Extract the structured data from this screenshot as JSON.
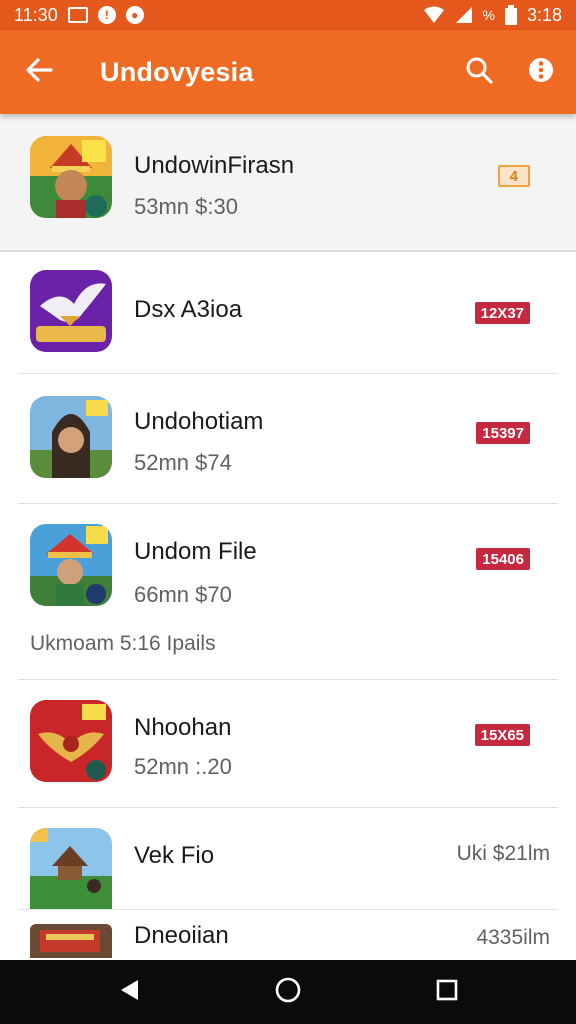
{
  "status_bar": {
    "time_left": "11:30",
    "time_right": "3:18",
    "battery_text": "%",
    "icons": [
      "image-icon",
      "alert-icon",
      "record-icon",
      "wifi-icon",
      "signal-icon",
      "battery-icon"
    ]
  },
  "app_bar": {
    "title": "Undovyesia",
    "icons": [
      "back-arrow-icon",
      "search-icon",
      "more-vert-icon"
    ]
  },
  "list": [
    {
      "title": "UndowinFirasn",
      "subtitle": "53mn $:30",
      "badge": "4",
      "badge_style": "orange"
    },
    {
      "title": "Dsx A3ioa",
      "subtitle": "",
      "badge": "12X37",
      "badge_style": "red"
    },
    {
      "title": "Undohotiam",
      "subtitle": "52mn $74",
      "badge": "15397",
      "badge_style": "red"
    },
    {
      "title": "Undom File",
      "subtitle": "66mn $70",
      "badge": "15406",
      "badge_style": "red",
      "extra": "Ukmoam 5:16 Ipails"
    },
    {
      "title": "Nhoohan",
      "subtitle": "52mn :.20",
      "badge": "15X65",
      "badge_style": "red"
    },
    {
      "title": "Vek Fio",
      "subtitle": "",
      "right": "Uki $21lm"
    },
    {
      "title": "Dneoiian",
      "subtitle": "",
      "right": "4335ilm"
    }
  ],
  "nav_bar": {
    "icons": [
      "back-triangle-icon",
      "home-circle-icon",
      "recents-square-icon"
    ]
  },
  "colors": {
    "status_bar": "#e4581c",
    "app_bar": "#ef6a22",
    "badge_red": "#c62840",
    "badge_orange": "#f0a040"
  }
}
